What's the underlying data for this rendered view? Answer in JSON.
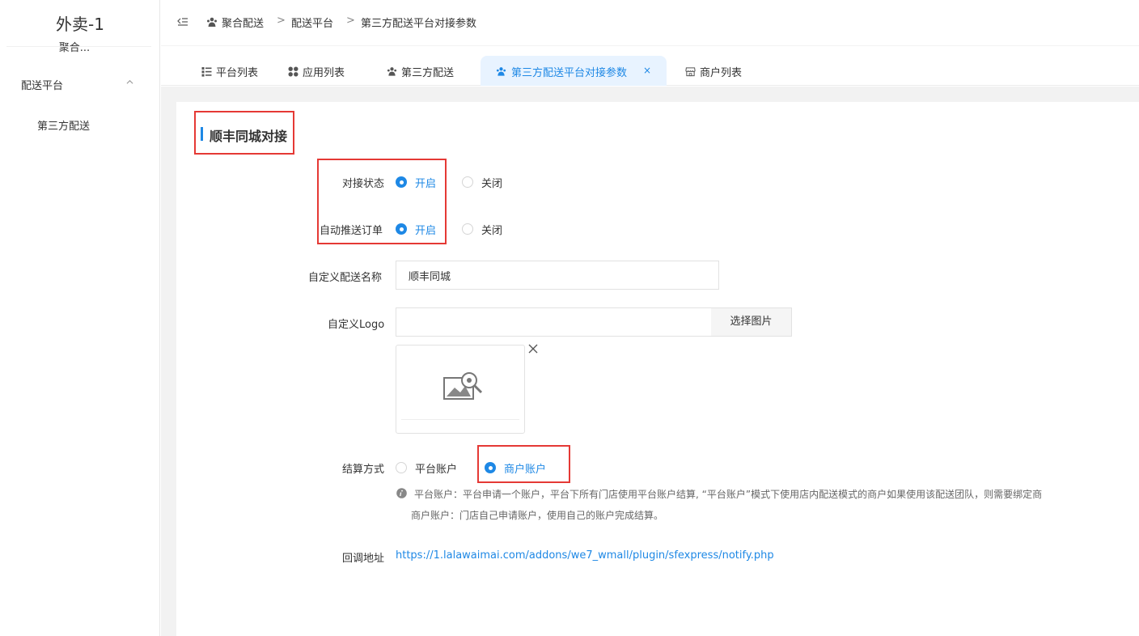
{
  "sidebar": {
    "app_title": "外卖-1",
    "app_subtitle": "聚合...",
    "group_label": "配送平台",
    "item_label": "第三方配送"
  },
  "breadcrumb": {
    "items": [
      "聚合配送",
      "配送平台",
      "第三方配送平台对接参数"
    ],
    "separator": ">"
  },
  "tabs": [
    {
      "label": "平台列表",
      "icon": "list-icon"
    },
    {
      "label": "应用列表",
      "icon": "apps-grid-icon"
    },
    {
      "label": "第三方配送",
      "icon": "users-icon"
    },
    {
      "label": "第三方配送平台对接参数",
      "icon": "users-icon",
      "active": true,
      "close": "×"
    },
    {
      "label": "商户列表",
      "icon": "shop-icon"
    }
  ],
  "form": {
    "section_title": "顺丰同城对接",
    "dock_status": {
      "label": "对接状态",
      "on": "开启",
      "off": "关闭",
      "value": "开启"
    },
    "auto_push": {
      "label": "自动推送订单",
      "on": "开启",
      "off": "关闭",
      "value": "开启"
    },
    "custom_name": {
      "label": "自定义配送名称",
      "value": "顺丰同城"
    },
    "custom_logo": {
      "label": "自定义Logo",
      "value": "",
      "button": "选择图片"
    },
    "settlement": {
      "label": "结算方式",
      "option_platform": "平台账户",
      "option_merchant": "商户账户",
      "value": "商户账户",
      "help_line1": "平台账户：平台申请一个账户，平台下所有门店使用平台账户结算, “平台账户”模式下使用店内配送模式的商户如果使用该配送团队，则需要绑定商",
      "help_line2": "商户账户：门店自己申请账户，使用自己的账户完成结算。"
    },
    "callback": {
      "label": "回调地址",
      "url": "https://1.lalawaimai.com/addons/we7_wmall/plugin/sfexpress/notify.php"
    }
  },
  "colors": {
    "accent": "#1e88e5",
    "highlight_border": "#e53935",
    "active_tab_bg": "#e8f3ff",
    "content_bg": "#f2f2f2"
  }
}
